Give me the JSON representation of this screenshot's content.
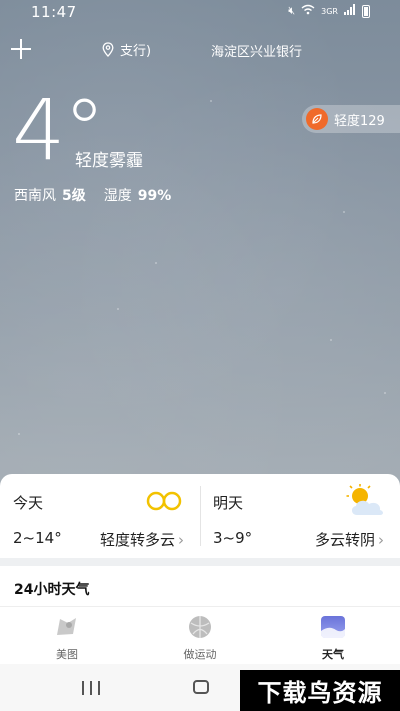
{
  "status_bar": {
    "time": "11:47",
    "network": "3GR"
  },
  "header": {
    "location_primary": "支行)",
    "location_secondary": "海淀区兴业银行"
  },
  "current": {
    "temperature": "4°",
    "condition": "轻度雾霾",
    "wind_label": "西南风",
    "wind_value": "5级",
    "humidity_label": "湿度",
    "humidity_value": "99%",
    "aqi": "轻度129"
  },
  "forecast": {
    "today": {
      "title": "今天",
      "range": "2~14°",
      "condition": "轻度转多云"
    },
    "tomorrow": {
      "title": "明天",
      "range": "3~9°",
      "condition": "多云转阴"
    }
  },
  "hourly": {
    "title": "24小时天气"
  },
  "nav": {
    "items": [
      {
        "label": "美图",
        "icon": "picture-icon"
      },
      {
        "label": "做运动",
        "icon": "ball-icon"
      },
      {
        "label": "天气",
        "icon": "weather-icon"
      }
    ]
  },
  "watermark": "下载鸟资源",
  "colors": {
    "aqi": "#f06a2a",
    "haze_icon": "#f2c200",
    "sun": "#f5b400"
  }
}
